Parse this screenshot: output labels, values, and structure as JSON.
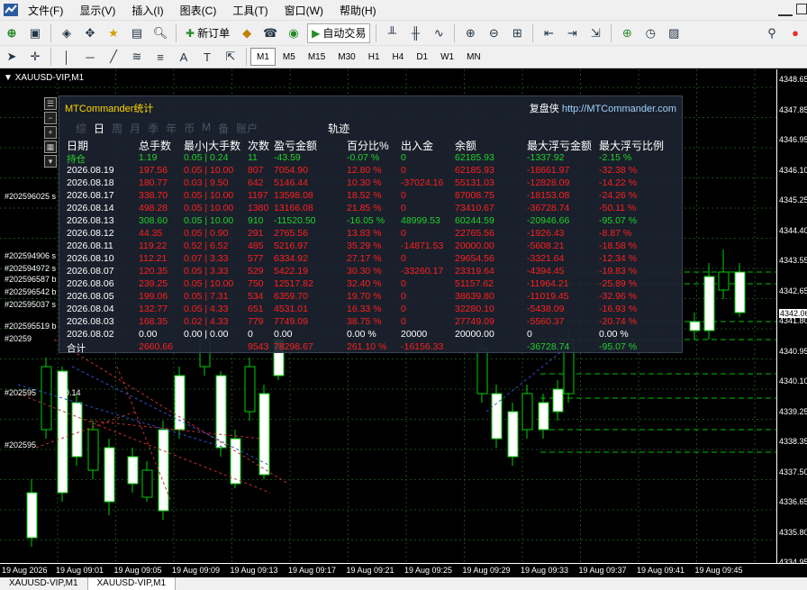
{
  "menubar": {
    "items": [
      "文件(F)",
      "显示(V)",
      "插入(I)",
      "图表(C)",
      "工具(T)",
      "窗口(W)",
      "帮助(H)"
    ]
  },
  "toolbar": {
    "new_order": "新订单",
    "auto_trade": "自动交易",
    "timeframes": [
      "M1",
      "M5",
      "M15",
      "M30",
      "H1",
      "H4",
      "D1",
      "W1",
      "MN"
    ],
    "active_timeframe": "M1"
  },
  "chart": {
    "title": "XAUUSD-VIP,M1",
    "price_labels": [
      "4348.65",
      "4347.85",
      "4346.95",
      "4346.10",
      "4345.25",
      "4344.40",
      "4343.55",
      "4342.65",
      "4341.80",
      "4340.95",
      "4340.10",
      "4339.25",
      "4338.35",
      "4337.50",
      "4336.65",
      "4335.80",
      "4334.95"
    ],
    "current_price": "4342.06",
    "time_labels": [
      "19 Aug 2026",
      "19 Aug 09:01",
      "19 Aug 09:05",
      "19 Aug 09:09",
      "19 Aug 09:13",
      "19 Aug 09:17",
      "19 Aug 09:21",
      "19 Aug 09:25",
      "19 Aug 09:29",
      "19 Aug 09:33",
      "19 Aug 09:37",
      "19 Aug 09:41",
      "19 Aug 09:45"
    ],
    "order_markers": [
      "#202596025 s",
      "#202594906 s",
      "#202594972 s",
      "#202596587 b",
      "#202596542 b",
      "#202595037 s",
      "#202595519 b",
      "#20259",
      "#202595",
      "0.14",
      "#202595",
      "1"
    ],
    "colors": {
      "bull_candle": "#ffffff",
      "bear_candle": "#000000",
      "wick": "#00d000",
      "grid": "#1a4a1a",
      "level": "#00c000"
    }
  },
  "tabs": [
    "XAUUSD-VIP,M1",
    "XAUUSD-VIP,M1"
  ],
  "panel": {
    "title": "MTCommander统计",
    "brand": "复盘侠",
    "url": "http://MTCommander.com",
    "period_tabs": [
      "综",
      "日",
      "周",
      "月",
      "季",
      "年",
      "币",
      "M",
      "备",
      "账户"
    ],
    "active_tab": "日",
    "track_label": "轨迹",
    "headers": [
      "日期",
      "总手数",
      "最小|大手数",
      "次数",
      "盈亏金额",
      "百分比%",
      "出入金",
      "余额",
      "最大浮亏金额",
      "最大浮亏比例"
    ],
    "rows": [
      {
        "date": "持仓",
        "lots": "1.19",
        "minmax": "0.05 | 0.24",
        "count": "11",
        "pnl": "-43.59",
        "pct": "-0.07 %",
        "flow": "0",
        "balance": "62185.93",
        "maxdd": "-1337.92",
        "maxddpct": "-2.15 %",
        "color": "up"
      },
      {
        "date": "2026.08.19",
        "lots": "197.56",
        "minmax": "0.05 | 10.00",
        "count": "807",
        "pnl": "7054.90",
        "pct": "12.80 %",
        "flow": "0",
        "balance": "62185.93",
        "maxdd": "-18661.97",
        "maxddpct": "-32.38 %",
        "color": "dn"
      },
      {
        "date": "2026.08.18",
        "lots": "180.77",
        "minmax": "0.03 | 9.50",
        "count": "642",
        "pnl": "5146.44",
        "pct": "10.30 %",
        "flow": "-37024.16",
        "balance": "55131.03",
        "maxdd": "-12828.09",
        "maxddpct": "-14.22 %",
        "color": "dn"
      },
      {
        "date": "2026.08.17",
        "lots": "338.70",
        "minmax": "0.05 | 10.00",
        "count": "1197",
        "pnl": "13598.08",
        "pct": "18.52 %",
        "flow": "0",
        "balance": "87008.75",
        "maxdd": "-18153.08",
        "maxddpct": "-24.26 %",
        "color": "dn"
      },
      {
        "date": "2026.08.14",
        "lots": "498.28",
        "minmax": "0.05 | 10.00",
        "count": "1380",
        "pnl": "13166.08",
        "pct": "21.85 %",
        "flow": "0",
        "balance": "73410.67",
        "maxdd": "-36728.74",
        "maxddpct": "-50.11 %",
        "color": "dn"
      },
      {
        "date": "2026.08.13",
        "lots": "308.60",
        "minmax": "0.05 | 10.00",
        "count": "910",
        "pnl": "-11520.50",
        "pct": "-16.05 %",
        "flow": "48999.53",
        "balance": "60244.59",
        "maxdd": "-20946.66",
        "maxddpct": "-95.07 %",
        "color": "up"
      },
      {
        "date": "2026.08.12",
        "lots": "44.35",
        "minmax": "0.05 | 0.90",
        "count": "291",
        "pnl": "2765.56",
        "pct": "13.83 %",
        "flow": "0",
        "balance": "22765.56",
        "maxdd": "-1926.43",
        "maxddpct": "-8.87 %",
        "color": "dn"
      },
      {
        "date": "2026.08.11",
        "lots": "119.22",
        "minmax": "0.52 | 6.52",
        "count": "485",
        "pnl": "5216.97",
        "pct": "35.29 %",
        "flow": "-14871.53",
        "balance": "20000.00",
        "maxdd": "-5608.21",
        "maxddpct": "-18.58 %",
        "color": "dn"
      },
      {
        "date": "2026.08.10",
        "lots": "112.21",
        "minmax": "0.07 | 3.33",
        "count": "577",
        "pnl": "6334.92",
        "pct": "27.17 %",
        "flow": "0",
        "balance": "29654.56",
        "maxdd": "-3321.64",
        "maxddpct": "-12.34 %",
        "color": "dn"
      },
      {
        "date": "2026.08.07",
        "lots": "120.35",
        "minmax": "0.05 | 3.33",
        "count": "529",
        "pnl": "5422.19",
        "pct": "30.30 %",
        "flow": "-33260.17",
        "balance": "23319.64",
        "maxdd": "-4394.45",
        "maxddpct": "-19.83 %",
        "color": "dn"
      },
      {
        "date": "2026.08.06",
        "lots": "239.25",
        "minmax": "0.05 | 10.00",
        "count": "750",
        "pnl": "12517.82",
        "pct": "32.40 %",
        "flow": "0",
        "balance": "51157.62",
        "maxdd": "-11964.21",
        "maxddpct": "-25.89 %",
        "color": "dn"
      },
      {
        "date": "2026.08.05",
        "lots": "199.06",
        "minmax": "0.05 | 7.31",
        "count": "534",
        "pnl": "6359.70",
        "pct": "19.70 %",
        "flow": "0",
        "balance": "38639.80",
        "maxdd": "-11019.45",
        "maxddpct": "-32.96 %",
        "color": "dn"
      },
      {
        "date": "2026.08.04",
        "lots": "132.77",
        "minmax": "0.05 | 4.33",
        "count": "651",
        "pnl": "4531.01",
        "pct": "16.33 %",
        "flow": "0",
        "balance": "32280.10",
        "maxdd": "-5438.09",
        "maxddpct": "-16.93 %",
        "color": "dn"
      },
      {
        "date": "2026.08.03",
        "lots": "168.35",
        "minmax": "0.02 | 4.33",
        "count": "779",
        "pnl": "7749.09",
        "pct": "38.75 %",
        "flow": "0",
        "balance": "27749.09",
        "maxdd": "-5560.37",
        "maxddpct": "-20.74 %",
        "color": "dn"
      },
      {
        "date": "2026.08.02",
        "lots": "0.00",
        "minmax": "0.00 | 0.00",
        "count": "0",
        "pnl": "0.00",
        "pct": "0.00 %",
        "flow": "20000",
        "balance": "20000.00",
        "maxdd": "0",
        "maxddpct": "0.00 %",
        "color": "wh"
      }
    ],
    "total": {
      "date": "合计",
      "lots": "2660.66",
      "count": "9543",
      "pnl": "78298.67",
      "pct": "261.10 %",
      "flow": "-16156.33",
      "maxdd": "-36728.74",
      "maxddpct": "-95.07 %"
    }
  }
}
